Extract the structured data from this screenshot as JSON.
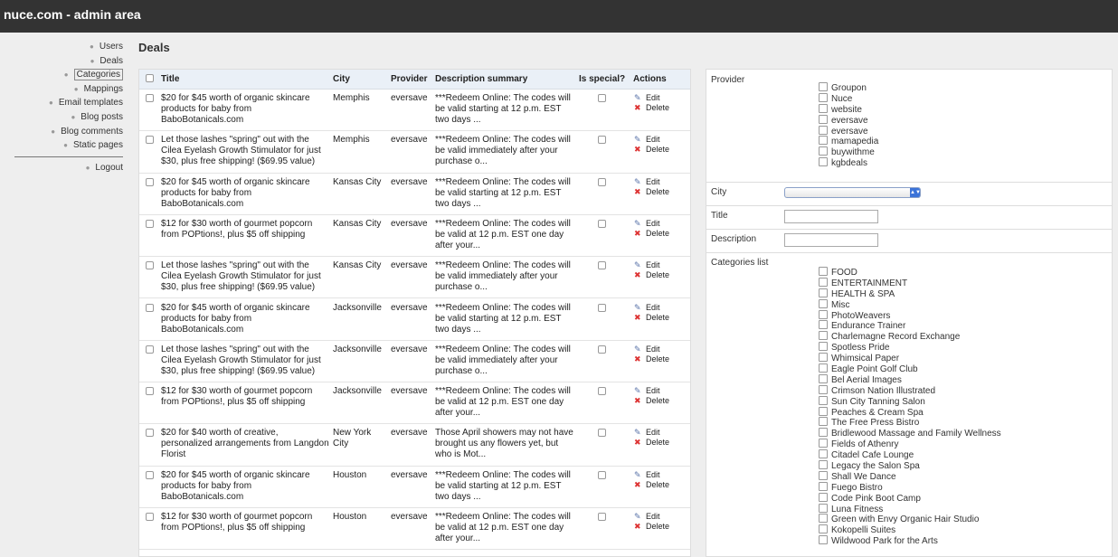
{
  "app": {
    "title": "nuce.com - admin area"
  },
  "sidebar": {
    "items": [
      {
        "label": "Users"
      },
      {
        "label": "Deals"
      },
      {
        "label": "Categories",
        "active": true
      },
      {
        "label": "Mappings"
      },
      {
        "label": "Email templates"
      },
      {
        "label": "Blog posts"
      },
      {
        "label": "Blog comments"
      },
      {
        "label": "Static pages"
      }
    ],
    "logout": "Logout"
  },
  "page": {
    "title": "Deals"
  },
  "table": {
    "columns": {
      "title": "Title",
      "city": "City",
      "provider": "Provider",
      "description": "Description summary",
      "special": "Is special?",
      "actions": "Actions"
    },
    "edit_label": "Edit",
    "delete_label": "Delete",
    "rows": [
      {
        "title": [
          "$20 for $45 worth of organic skincare",
          "products for baby from",
          "BaboBotanicals.com"
        ],
        "city": [
          "Memphis"
        ],
        "provider": "eversave",
        "desc": [
          "***Redeem Online: The codes will",
          "be valid starting at 12 p.m. EST",
          "two days ..."
        ]
      },
      {
        "title": [
          "Let those lashes \"spring\" out with the",
          "Cilea Eyelash Growth Stimulator for just",
          "$30, plus free shipping! ($69.95 value)"
        ],
        "city": [
          "Memphis"
        ],
        "provider": "eversave",
        "desc": [
          "***Redeem Online: The codes will",
          "be valid immediately after your",
          "purchase o..."
        ]
      },
      {
        "title": [
          "$20 for $45 worth of organic skincare",
          "products for baby from",
          "BaboBotanicals.com"
        ],
        "city": [
          "Kansas City"
        ],
        "provider": "eversave",
        "desc": [
          "***Redeem Online: The codes will",
          "be valid starting at 12 p.m. EST",
          "two days ..."
        ]
      },
      {
        "title": [
          "$12 for $30 worth of gourmet popcorn",
          "from POPtions!, plus $5 off shipping"
        ],
        "city": [
          "Kansas City"
        ],
        "provider": "eversave",
        "desc": [
          "***Redeem Online: The codes will",
          "be valid at 12 p.m. EST one day",
          "after your..."
        ]
      },
      {
        "title": [
          "Let those lashes \"spring\" out with the",
          "Cilea Eyelash Growth Stimulator for just",
          "$30, plus free shipping! ($69.95 value)"
        ],
        "city": [
          "Kansas City"
        ],
        "provider": "eversave",
        "desc": [
          "***Redeem Online: The codes will",
          "be valid immediately after your",
          "purchase o..."
        ]
      },
      {
        "title": [
          "$20 for $45 worth of organic skincare",
          "products for baby from",
          "BaboBotanicals.com"
        ],
        "city": [
          "Jacksonville"
        ],
        "provider": "eversave",
        "desc": [
          "***Redeem Online: The codes will",
          "be valid starting at 12 p.m. EST",
          "two days ..."
        ]
      },
      {
        "title": [
          "Let those lashes \"spring\" out with the",
          "Cilea Eyelash Growth Stimulator for just",
          "$30, plus free shipping! ($69.95 value)"
        ],
        "city": [
          "Jacksonville"
        ],
        "provider": "eversave",
        "desc": [
          "***Redeem Online: The codes will",
          "be valid immediately after your",
          "purchase o..."
        ]
      },
      {
        "title": [
          "$12 for $30 worth of gourmet popcorn",
          "from POPtions!, plus $5 off shipping"
        ],
        "city": [
          "Jacksonville"
        ],
        "provider": "eversave",
        "desc": [
          "***Redeem Online: The codes will",
          "be valid at 12 p.m. EST one day",
          "after your..."
        ]
      },
      {
        "title": [
          "$20 for $40 worth of creative,",
          "personalized arrangements from Langdon",
          "Florist"
        ],
        "city": [
          "New York",
          "City"
        ],
        "provider": "eversave",
        "desc": [
          "Those April showers may not have",
          "brought us any flowers yet, but",
          "who is Mot..."
        ]
      },
      {
        "title": [
          "$20 for $45 worth of organic skincare",
          "products for baby from",
          "BaboBotanicals.com"
        ],
        "city": [
          "Houston"
        ],
        "provider": "eversave",
        "desc": [
          "***Redeem Online: The codes will",
          "be valid starting at 12 p.m. EST",
          "two days ..."
        ]
      },
      {
        "title": [
          "$12 for $30 worth of gourmet popcorn",
          "from POPtions!, plus $5 off shipping"
        ],
        "city": [
          "Houston"
        ],
        "provider": "eversave",
        "desc": [
          "***Redeem Online: The codes will",
          "be valid at 12 p.m. EST one day",
          "after your..."
        ]
      }
    ]
  },
  "filters": {
    "provider_label": "Provider",
    "providers": [
      "Groupon",
      "Nuce",
      "website",
      "eversave",
      "eversave",
      "mamapedia",
      "buywithme",
      "kgbdeals"
    ],
    "city_label": "City",
    "city_value": "",
    "title_label": "Title",
    "title_value": "",
    "description_label": "Description",
    "description_value": "",
    "categories_label": "Categories list",
    "categories": [
      "FOOD",
      "ENTERTAINMENT",
      "HEALTH & SPA",
      "Misc",
      "PhotoWeavers",
      "Endurance Trainer",
      "Charlemagne Record Exchange",
      "Spotless Pride",
      "Whimsical Paper",
      "Eagle Point Golf Club",
      "Bel Aerial Images",
      "Crimson Nation Illustrated",
      "Sun City Tanning Salon",
      "Peaches & Cream Spa",
      "The Free Press Bistro",
      "Bridlewood Massage and Family Wellness",
      "Fields of Athenry",
      "Citadel Cafe Lounge",
      "Legacy the Salon Spa",
      "Shall We Dance",
      "Fuego Bistro",
      "Code Pink Boot Camp",
      "Luna Fitness",
      "Green with Envy Organic Hair Studio",
      "Kokopelli Suites",
      "Wildwood Park for the Arts"
    ]
  },
  "colors": {
    "topbar": "#333333",
    "background": "#eeeeee",
    "table_header": "#eaf0f7",
    "delete_icon": "#dd3333",
    "edit_icon": "#5872a8"
  }
}
